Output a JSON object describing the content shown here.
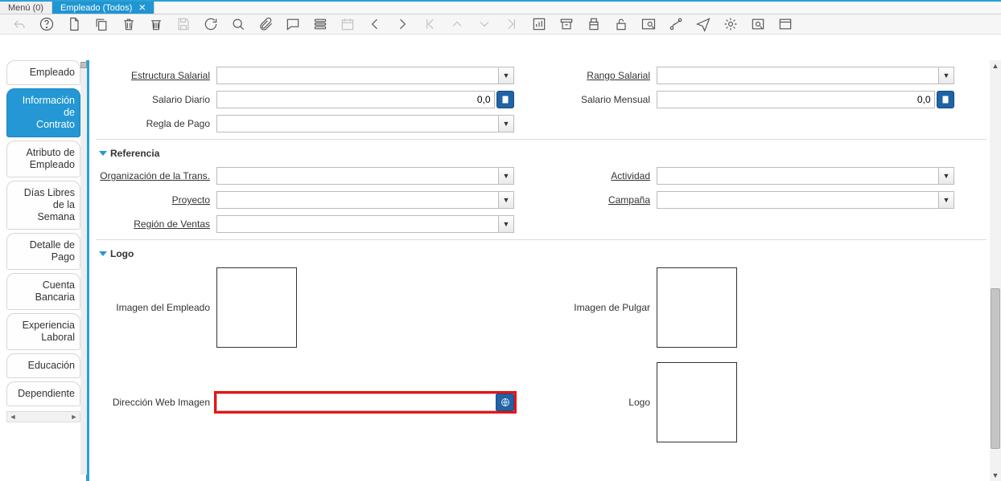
{
  "tabs": {
    "menu": "Menú (0)",
    "active": "Empleado (Todos)"
  },
  "side": {
    "items": [
      {
        "label": "Empleado"
      },
      {
        "label": "Información\nde\nContrato",
        "active": true
      },
      {
        "label": "Atributo de\nEmpleado"
      },
      {
        "label": "Días Libres\nde la\nSemana"
      },
      {
        "label": "Detalle de\nPago"
      },
      {
        "label": "Cuenta\nBancaria"
      },
      {
        "label": "Experiencia\nLaboral"
      },
      {
        "label": "Educación"
      },
      {
        "label": "Dependiente"
      }
    ]
  },
  "form": {
    "salary_structure_label": "Estructura Salarial",
    "salary_structure_value": "",
    "pay_grade_label": "Rango Salarial",
    "pay_grade_value": "",
    "daily_salary_label": "Salario Diario",
    "daily_salary_value": "0,0",
    "monthly_salary_label": "Salario Mensual",
    "monthly_salary_value": "0,0",
    "payment_rule_label": "Regla de Pago",
    "payment_rule_value": "",
    "reference_section": "Referencia",
    "trx_org_label": "Organización de la Trans.",
    "trx_org_value": "",
    "activity_label": "Actividad",
    "activity_value": "",
    "project_label": "Proyecto",
    "project_value": "",
    "campaign_label": "Campaña",
    "campaign_value": "",
    "sales_region_label": "Región de Ventas",
    "sales_region_value": "",
    "logo_section": "Logo",
    "employee_image_label": "Imagen del Empleado",
    "thumb_image_label": "Imagen de Pulgar",
    "image_url_label": "Dirección Web Imagen",
    "image_url_value": "",
    "logo_label": "Logo"
  }
}
